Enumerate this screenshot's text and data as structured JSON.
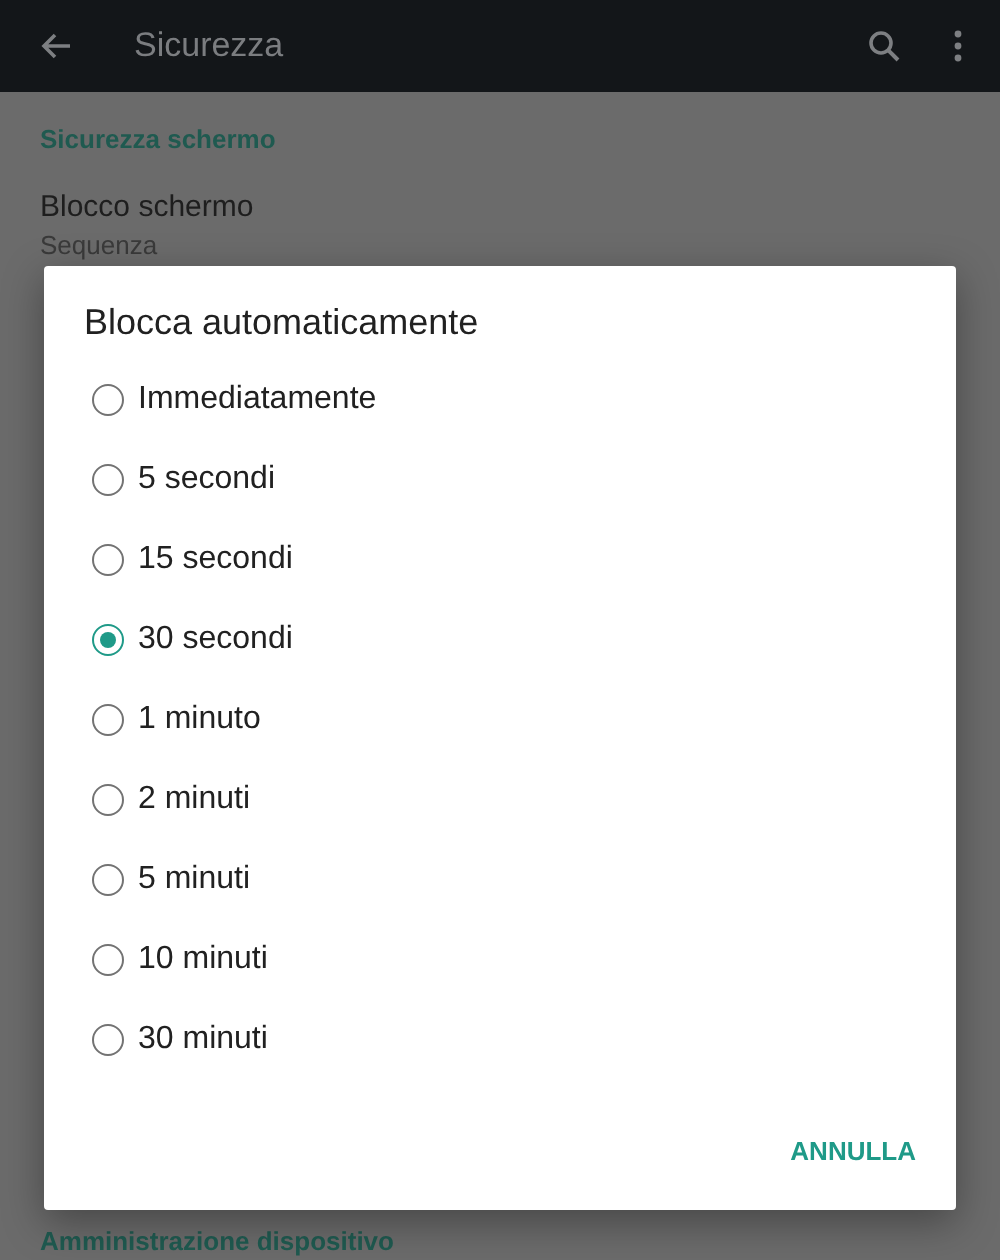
{
  "app_bar": {
    "title": "Sicurezza"
  },
  "settings": {
    "section_header": "Sicurezza schermo",
    "item_title": "Blocco schermo",
    "item_summary": "Sequenza",
    "footer_section_header": "Amministrazione dispositivo"
  },
  "dialog": {
    "title": "Blocca automaticamente",
    "options": [
      {
        "label": "Immediatamente",
        "selected": false
      },
      {
        "label": "5 secondi",
        "selected": false
      },
      {
        "label": "15 secondi",
        "selected": false
      },
      {
        "label": "30 secondi",
        "selected": true
      },
      {
        "label": "1 minuto",
        "selected": false
      },
      {
        "label": "2 minuti",
        "selected": false
      },
      {
        "label": "5 minuti",
        "selected": false
      },
      {
        "label": "10 minuti",
        "selected": false
      },
      {
        "label": "30 minuti",
        "selected": false
      }
    ],
    "button": "ANNULLA"
  }
}
